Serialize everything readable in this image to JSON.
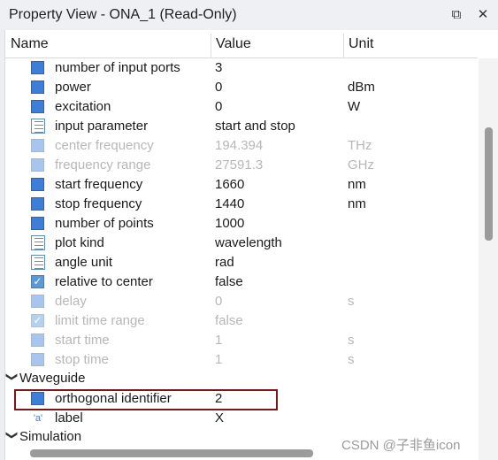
{
  "window": {
    "title": "Property View - ONA_1 (Read-Only)",
    "restore_icon": "⧉",
    "close_icon": "✕"
  },
  "columns": {
    "name": "Name",
    "value": "Value",
    "unit": "Unit"
  },
  "rows": [
    {
      "name": "number of input ports",
      "value": "3",
      "unit": "",
      "icon": "square",
      "disabled": false
    },
    {
      "name": "power",
      "value": "0",
      "unit": "dBm",
      "icon": "square",
      "disabled": false
    },
    {
      "name": "excitation",
      "value": "0",
      "unit": "W",
      "icon": "square",
      "disabled": false
    },
    {
      "name": "input parameter",
      "value": "start and stop",
      "unit": "",
      "icon": "list",
      "disabled": false
    },
    {
      "name": "center frequency",
      "value": "194.394",
      "unit": "THz",
      "icon": "square",
      "disabled": true
    },
    {
      "name": "frequency range",
      "value": "27591.3",
      "unit": "GHz",
      "icon": "square",
      "disabled": true
    },
    {
      "name": "start frequency",
      "value": "1660",
      "unit": "nm",
      "icon": "square",
      "disabled": false
    },
    {
      "name": "stop frequency",
      "value": "1440",
      "unit": "nm",
      "icon": "square",
      "disabled": false
    },
    {
      "name": "number of points",
      "value": "1000",
      "unit": "",
      "icon": "square",
      "disabled": false
    },
    {
      "name": "plot kind",
      "value": "wavelength",
      "unit": "",
      "icon": "list",
      "disabled": false
    },
    {
      "name": "angle unit",
      "value": "rad",
      "unit": "",
      "icon": "list",
      "disabled": false
    },
    {
      "name": "relative to center",
      "value": "false",
      "unit": "",
      "icon": "check",
      "disabled": false
    },
    {
      "name": "delay",
      "value": "0",
      "unit": "s",
      "icon": "square",
      "disabled": true
    },
    {
      "name": "limit time range",
      "value": "false",
      "unit": "",
      "icon": "check",
      "disabled": true
    },
    {
      "name": "start time",
      "value": "1",
      "unit": "s",
      "icon": "square",
      "disabled": true
    },
    {
      "name": "stop time",
      "value": "1",
      "unit": "s",
      "icon": "square",
      "disabled": true
    }
  ],
  "groups": {
    "waveguide": "Waveguide",
    "simulation": "Simulation"
  },
  "waveguide_rows": [
    {
      "name": "orthogonal identifier",
      "value": "2",
      "unit": "",
      "icon": "square",
      "disabled": false
    },
    {
      "name": "label",
      "value": "X",
      "unit": "",
      "icon": "text",
      "disabled": false
    }
  ],
  "text_icon_glyph": "'a'",
  "watermark": "CSDN @子非鱼icon"
}
